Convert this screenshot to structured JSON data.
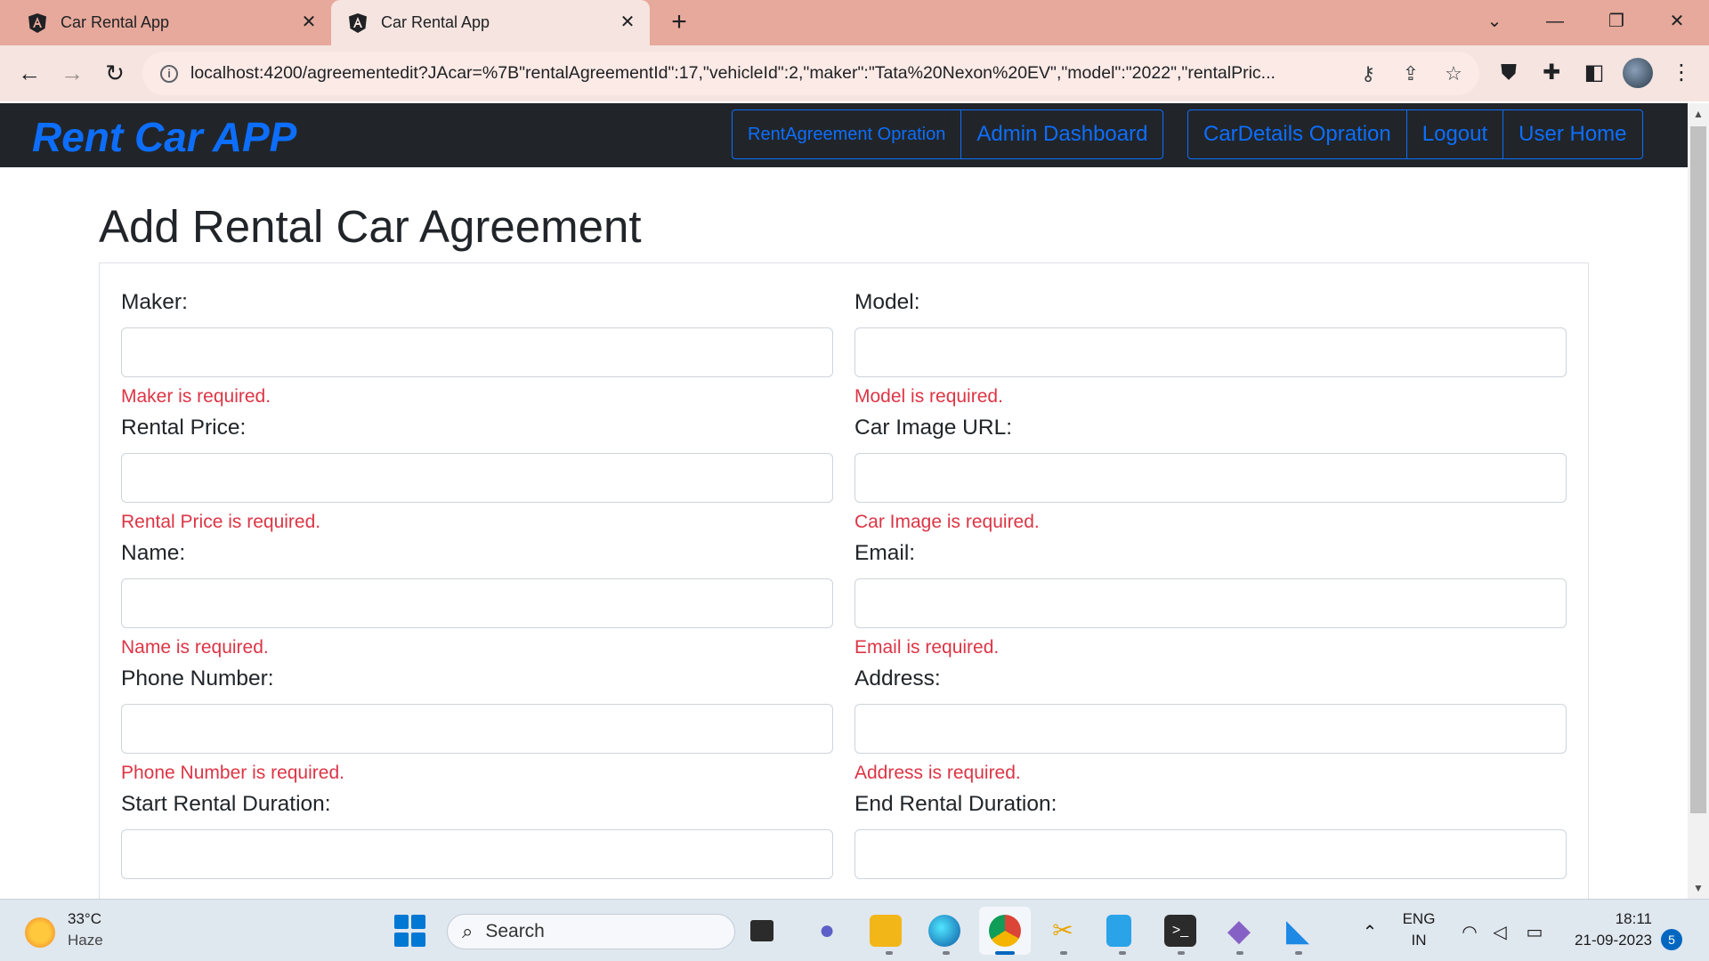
{
  "browser": {
    "tabs": [
      {
        "title": "Car Rental App",
        "active": false
      },
      {
        "title": "Car Rental App",
        "active": true
      }
    ],
    "new_tab": "+",
    "url": "localhost:4200/agreementedit?JAcar=%7B\"rentalAgreementId\":17,\"vehicleId\":2,\"maker\":\"Tata%20Nexon%20EV\",\"model\":\"2022\",\"rentalPric..."
  },
  "navbar": {
    "brand": "Rent Car APP",
    "group1": [
      "RentAgreement Opration",
      "Admin Dashboard"
    ],
    "group2": [
      "CarDetails Opration",
      "Logout",
      "User Home"
    ]
  },
  "page": {
    "title": "Add Rental Car Agreement",
    "fields": [
      {
        "label": "Maker:",
        "value": "",
        "error": "Maker is required."
      },
      {
        "label": "Model:",
        "value": "",
        "error": "Model is required."
      },
      {
        "label": "Rental Price:",
        "value": "",
        "error": "Rental Price is required."
      },
      {
        "label": "Car Image URL:",
        "value": "",
        "error": "Car Image is required."
      },
      {
        "label": "Name:",
        "value": "",
        "error": "Name is required."
      },
      {
        "label": "Email:",
        "value": "",
        "error": "Email is required."
      },
      {
        "label": "Phone Number:",
        "value": "",
        "error": "Phone Number is required."
      },
      {
        "label": "Address:",
        "value": "",
        "error": "Address is required."
      },
      {
        "label": "Start Rental Duration:",
        "value": ""
      },
      {
        "label": "End Rental Duration:",
        "value": ""
      }
    ]
  },
  "taskbar": {
    "weather": {
      "temp": "33°C",
      "desc": "Haze"
    },
    "search_label": "Search",
    "lang": {
      "line1": "ENG",
      "line2": "IN"
    },
    "clock": {
      "time": "18:11",
      "date": "21-09-2023"
    },
    "notifications": "5"
  },
  "colors": {
    "primary": "#0d6efd",
    "error": "#dc3545",
    "navbar_bg": "#212529",
    "tabstrip_bg": "#e6a99b"
  }
}
